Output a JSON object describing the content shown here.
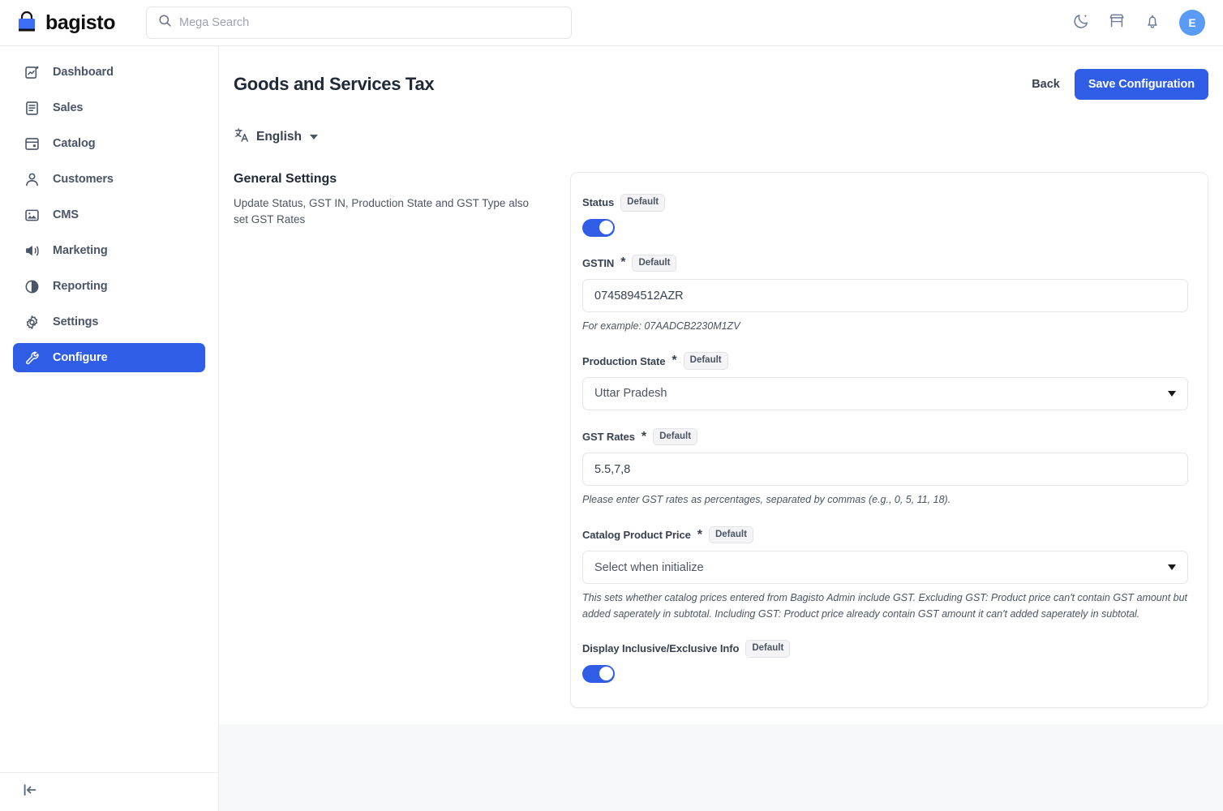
{
  "topbar": {
    "brand": "bagisto",
    "search": {
      "placeholder": "Mega Search",
      "value": ""
    },
    "icons": {
      "dark_mode": "moon-icon",
      "store": "store-icon",
      "notifications": "bell-icon"
    },
    "avatar_initial": "E"
  },
  "sidebar": {
    "items": [
      {
        "label": "Dashboard",
        "icon": "dashboard-icon",
        "active": false
      },
      {
        "label": "Sales",
        "icon": "sales-icon",
        "active": false
      },
      {
        "label": "Catalog",
        "icon": "catalog-icon",
        "active": false
      },
      {
        "label": "Customers",
        "icon": "customers-icon",
        "active": false
      },
      {
        "label": "CMS",
        "icon": "cms-icon",
        "active": false
      },
      {
        "label": "Marketing",
        "icon": "marketing-icon",
        "active": false
      },
      {
        "label": "Reporting",
        "icon": "reporting-icon",
        "active": false
      },
      {
        "label": "Settings",
        "icon": "settings-icon",
        "active": false
      },
      {
        "label": "Configure",
        "icon": "configure-icon",
        "active": true
      }
    ],
    "collapse_icon": "collapse-sidebar-icon"
  },
  "page": {
    "title": "Goods and Services Tax",
    "back_label": "Back",
    "save_label": "Save Configuration",
    "language": {
      "label": "English",
      "icon": "translate-icon"
    }
  },
  "section": {
    "title": "General Settings",
    "description": "Update Status, GST IN, Production State and GST Type also set GST Rates"
  },
  "fields": {
    "status": {
      "label": "Status",
      "badge": "Default",
      "toggle_on": true
    },
    "gstin": {
      "label": "GSTIN",
      "required": "*",
      "badge": "Default",
      "value": "0745894512AZR",
      "hint": "For example: 07AADCB2230M1ZV"
    },
    "production_state": {
      "label": "Production State",
      "required": "*",
      "badge": "Default",
      "value": "Uttar Pradesh"
    },
    "gst_rates": {
      "label": "GST Rates",
      "required": "*",
      "badge": "Default",
      "value": "5.5,7,8",
      "hint": "Please enter GST rates as percentages, separated by commas (e.g., 0, 5, 11, 18)."
    },
    "catalog_product_price": {
      "label": "Catalog Product Price",
      "required": "*",
      "badge": "Default",
      "value": "Select when initialize",
      "hint": "This sets whether catalog prices entered from Bagisto Admin include GST. Excluding GST: Product price can't contain GST amount but added saperately in subtotal. Including GST: Product price already contain GST amount it can't added saperately in subtotal."
    },
    "display_inclusive_exclusive": {
      "label": "Display Inclusive/Exclusive Info",
      "badge": "Default",
      "toggle_on": true
    }
  },
  "colors": {
    "primary": "#2f5de6",
    "avatar": "#5b9bf8",
    "page_bg": "#f7f8fa"
  }
}
